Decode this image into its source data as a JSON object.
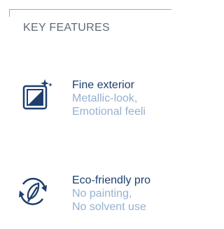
{
  "section": {
    "title": "KEY FEATURES"
  },
  "features": [
    {
      "icon": "sparkle-frame-icon",
      "title": "Fine exterior",
      "lines": [
        "Metallic-look,",
        "Emotional feeli"
      ]
    },
    {
      "icon": "eco-leaf-icon",
      "title": "Eco-friendly pro",
      "lines": [
        "No painting,",
        "No solvent use"
      ]
    }
  ],
  "colors": {
    "title": "#1c3f6e",
    "subtitle": "#96b1cf",
    "heading": "#5f6a75",
    "frame": "#a0aab4"
  }
}
